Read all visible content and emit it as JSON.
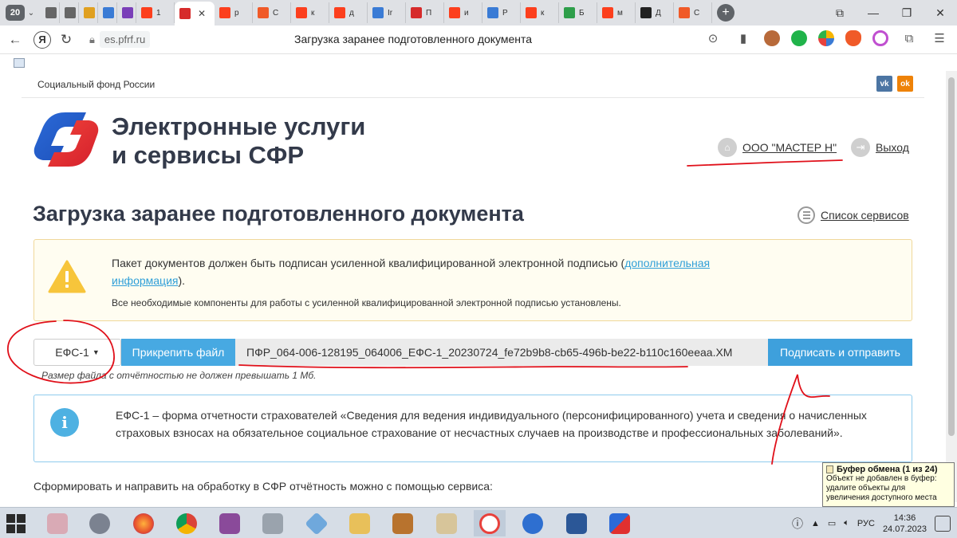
{
  "browser": {
    "tab_count": "20",
    "tabs": [
      {
        "label": "",
        "icon": "document-icon",
        "color": "#666666"
      },
      {
        "label": "",
        "icon": "document-icon",
        "color": "#666666"
      },
      {
        "label": "",
        "icon": "colorful-icon",
        "color": "#e0a020"
      },
      {
        "label": "",
        "icon": "blue-square-icon",
        "color": "#3a7bd5"
      },
      {
        "label": "",
        "icon": "purple-bars-icon",
        "color": "#7a3fb8"
      },
      {
        "label": "1",
        "icon": "yandex-icon",
        "color": "#fc3f1d"
      },
      {
        "label": "",
        "icon": "pfr-icon",
        "color": "#d62b2b",
        "active": true
      },
      {
        "label": "р",
        "icon": "yandex-icon",
        "color": "#fc3f1d"
      },
      {
        "label": "С",
        "icon": "flame-icon",
        "color": "#f05a28"
      },
      {
        "label": "к",
        "icon": "yandex-icon",
        "color": "#fc3f1d"
      },
      {
        "label": "д",
        "icon": "yandex-icon",
        "color": "#fc3f1d"
      },
      {
        "label": "Ir",
        "icon": "shield-icon",
        "color": "#3a7bd5"
      },
      {
        "label": "П",
        "icon": "stripe-icon",
        "color": "#d62b2b"
      },
      {
        "label": "и",
        "icon": "yandex-icon",
        "color": "#fc3f1d"
      },
      {
        "label": "Р",
        "icon": "shield-icon",
        "color": "#3a7bd5"
      },
      {
        "label": "к",
        "icon": "yandex-icon",
        "color": "#fc3f1d"
      },
      {
        "label": "Б",
        "icon": "dollar-icon",
        "color": "#2e9e4a"
      },
      {
        "label": "м",
        "icon": "yandex-icon",
        "color": "#fc3f1d"
      },
      {
        "label": "Д",
        "icon": "compass-icon",
        "color": "#222222"
      },
      {
        "label": "С",
        "icon": "flame-icon",
        "color": "#f05a28"
      }
    ],
    "url": "es.pfrf.ru",
    "page_title": "Загрузка заранее подготовленного документа",
    "yandex_letter": "Я"
  },
  "site": {
    "org_name": "Социальный фонд России",
    "social": {
      "vk": "vk",
      "ok": "ok"
    },
    "brand_line1": "Электронные услуги",
    "brand_line2": "и сервисы СФР",
    "company": "ООО \"МАСТЕР Н\"",
    "logout": "Выход"
  },
  "main": {
    "title": "Загрузка заранее подготовленного документа",
    "services_link": "Список сервисов",
    "warning": {
      "text_before": "Пакет документов должен быть подписан усиленной квалифицированной электронной подписью (",
      "link": "дополнительная информация",
      "text_after": ").",
      "sub": "Все необходимые компоненты для работы с усиленной квалифицированной электронной подписью установлены."
    },
    "upload": {
      "form_type": "ЕФС-1",
      "attach_label": "Прикрепить файл",
      "file_name": "ПФР_064-006-128195_064006_ЕФС-1_20230724_fe72b9b8-cb65-496b-be22-b110c160eeaa.XM",
      "submit_label": "Подписать и отправить",
      "hint": "Размер файла с отчётностью не должен превышать 1 Мб."
    },
    "info": "ЕФС-1 – форма отчетности страхователей «Сведения для ведения индивидуального (персонифицированного) учета и сведения о начисленных страховых взносах на обязательное социальное страхование от несчастных случаев на производстве и профессиональных заболеваний».",
    "bottom": "Сформировать и направить на обработку в СФР отчётность можно с помощью сервиса:"
  },
  "clipboard": {
    "title": "Буфер обмена (1 из 24)",
    "message": "Объект не добавлен в буфер: удалите объекты для увеличения доступного места"
  },
  "taskbar": {
    "lang": "РУС",
    "time": "14:36",
    "date": "24.07.2023"
  },
  "colors": {
    "accent_blue": "#47a9e2",
    "annotation_red": "#e0101a"
  }
}
